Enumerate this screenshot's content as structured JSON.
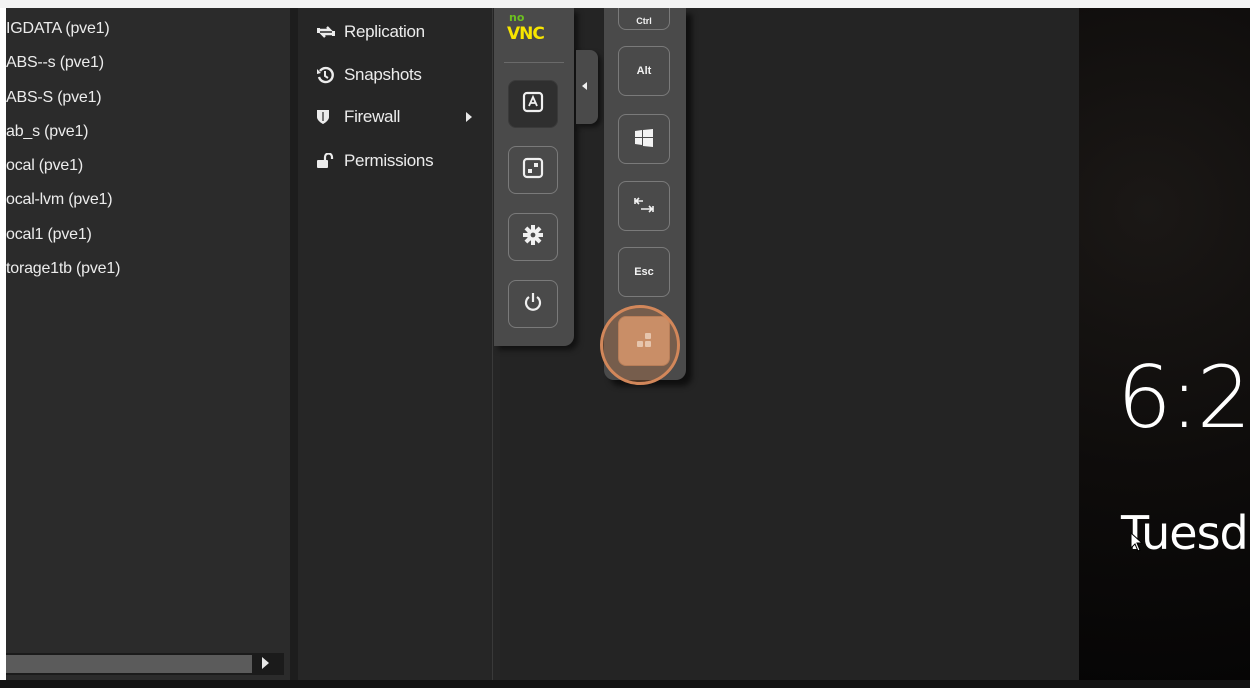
{
  "storage_tree": {
    "items": [
      "IGDATA (pve1)",
      "ABS--s (pve1)",
      "ABS-S (pve1)",
      "ab_s (pve1)",
      "ocal (pve1)",
      "ocal-lvm (pve1)",
      "ocal1 (pve1)",
      "torage1tb (pve1)"
    ]
  },
  "vm_menu": {
    "items": [
      {
        "label": "Replication",
        "icon": "replication-icon"
      },
      {
        "label": "Snapshots",
        "icon": "history-icon"
      },
      {
        "label": "Firewall",
        "icon": "shield-icon"
      },
      {
        "label": "Permissions",
        "icon": "unlock-icon"
      }
    ]
  },
  "novnc": {
    "logo_top": "no",
    "logo_bottom": "VNC",
    "buttons": [
      "keyboard-icon",
      "extra-keys-icon",
      "settings-icon",
      "power-icon"
    ]
  },
  "extra_keys": {
    "ctrl": "Ctrl",
    "alt": "Alt",
    "windows": "windows-icon",
    "tab": "tab-icon",
    "esc": "Esc",
    "ctrl_alt_del": "ctrl-alt-del-icon"
  },
  "console": {
    "time": "6:2",
    "day": "Tuesd"
  },
  "colors": {
    "accent_highlight": "#d2875a",
    "novnc_green": "#6cc020",
    "novnc_yellow": "#f7e500"
  }
}
